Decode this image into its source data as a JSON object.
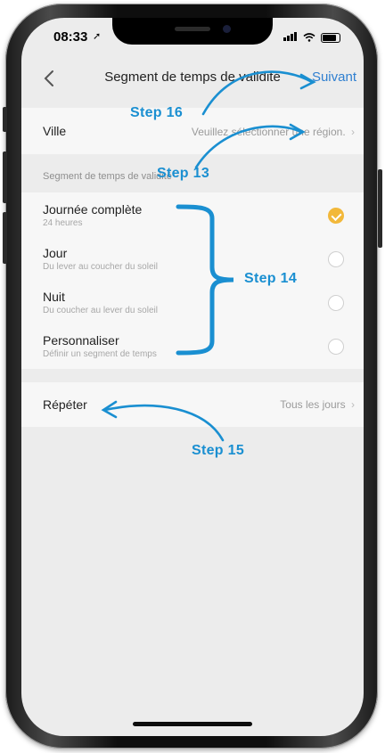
{
  "status": {
    "time": "08:33"
  },
  "nav": {
    "title": "Segment de temps de validité",
    "next_label": "Suivant"
  },
  "city": {
    "label": "Ville",
    "value": "Veuillez sélectionner une région."
  },
  "segment_header": "Segment de temps de validité",
  "segments": [
    {
      "label": "Journée complète",
      "sub": "24 heures",
      "selected": true
    },
    {
      "label": "Jour",
      "sub": "Du lever au coucher du soleil",
      "selected": false
    },
    {
      "label": "Nuit",
      "sub": "Du coucher au lever du soleil",
      "selected": false
    },
    {
      "label": "Personnaliser",
      "sub": "Définir un segment de temps",
      "selected": false
    }
  ],
  "repeat": {
    "label": "Répéter",
    "value": "Tous les jours"
  },
  "annotations": {
    "step13": "Step 13",
    "step14": "Step 14",
    "step15": "Step 15",
    "step16": "Step 16"
  },
  "colors": {
    "accent": "#1a8fd1",
    "link": "#2f7fd0",
    "check": "#f2b83a"
  }
}
